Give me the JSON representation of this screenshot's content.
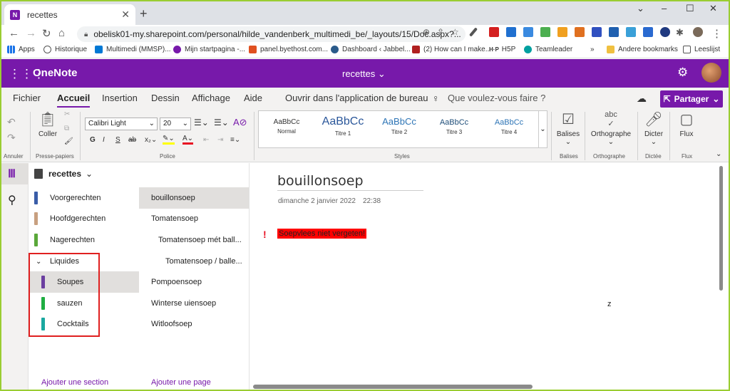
{
  "browser": {
    "tab_title": "recettes",
    "tab_favicon": "N",
    "url": "obelisk01-my.sharepoint.com/personal/hilde_vandenberk_multimedi_be/_layouts/15/Doc.aspx?...",
    "bookmarks": [
      "Apps",
      "Historique",
      "Multimedi (MMSP)...",
      "Mijn startpagina -...",
      "panel.byethost.com...",
      "Dashboard ‹ Jabbel...",
      "(2) How can I make...",
      "H5P",
      "Teamleader",
      "»",
      "Andere bookmarks",
      "Leeslijst"
    ],
    "win_min": "⌄",
    "win_max": "–",
    "win_restore": "☐",
    "win_close": "✕"
  },
  "app": {
    "name": "OneNote",
    "notebook_title": "recettes ⌄",
    "accent": "#7719aa"
  },
  "ribbon": {
    "tabs": [
      "Fichier",
      "Accueil",
      "Insertion",
      "Dessin",
      "Affichage",
      "Aide"
    ],
    "open_desktop": "Ouvrir dans l'application de bureau",
    "search_placeholder": "Que voulez-vous faire ?",
    "share": "Partager",
    "undo_label": "Annuler",
    "paste": "Coller",
    "clipboard_label": "Presse-papiers",
    "font_name": "Calibri Light",
    "font_size": "20",
    "font_label": "Police",
    "styles_label": "Styles",
    "styles": [
      {
        "sample": "AaBbCc",
        "name": "Normal"
      },
      {
        "sample": "AaBbCc",
        "name": "Titre 1"
      },
      {
        "sample": "AaBbCc",
        "name": "Titre 2"
      },
      {
        "sample": "AaBbCc",
        "name": "Titre 3"
      },
      {
        "sample": "AaBbCc",
        "name": "Titre 4"
      }
    ],
    "tags": "Balises",
    "tags_group": "Balises",
    "spelling": "Orthographe",
    "spelling_group": "Orthographe",
    "dictate": "Dicter",
    "dictate_group": "Dictée",
    "flux": "Flux",
    "flux_group": "Flux"
  },
  "notebook": {
    "name": "recettes",
    "sections": [
      {
        "label": "Voorgerechten",
        "color": "#3a5da8"
      },
      {
        "label": "Hoofdgerechten",
        "color": "#c8a080"
      },
      {
        "label": "Nagerechten",
        "color": "#5aa83a"
      },
      {
        "label": "Liquides",
        "color": ""
      },
      {
        "label": "Soupes",
        "color": "#6b3fa0"
      },
      {
        "label": "sauzen",
        "color": "#1fae42"
      },
      {
        "label": "Cocktails",
        "color": "#1aa8a0"
      }
    ],
    "add_section": "Ajouter une section",
    "pages": [
      "bouillonsoep",
      "Tomatensoep",
      "Tomatensoep mét ball...",
      "Tomatensoep / balle...",
      "Pompoensoep",
      "Winterse uiensoep",
      "Witloofsoep"
    ],
    "add_page": "Ajouter une page"
  },
  "page": {
    "title": "bouillonsoep",
    "date": "dimanche 2 janvier 2022",
    "time": "22:38",
    "important_mark": "!",
    "note": "Soepvlees niet vergeten!",
    "stray": "z"
  }
}
